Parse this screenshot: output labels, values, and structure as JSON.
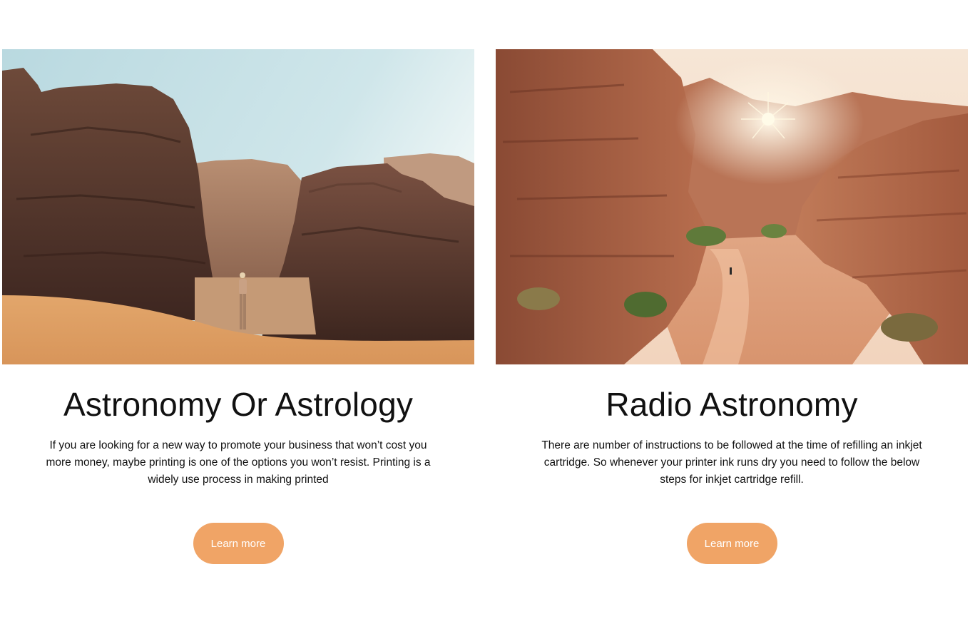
{
  "cards": [
    {
      "image_alt": "Person standing on a sand dune facing tall desert rock formations",
      "title": "Astronomy Or Astrology",
      "text": "If you are looking for a new way to promote your business that won’t cost you more money, maybe printing is one of the options you won’t resist. Printing is a widely use process in making printed",
      "button_label": "Learn more"
    },
    {
      "image_alt": "Aerial view of a red sandstone canyon with a sandy path and the sun flaring over the cliffs",
      "title": "Radio Astronomy",
      "text": "There are number of instructions to be followed at the time of refilling an inkjet cartridge. So whenever your printer ink runs dry you need to follow the below steps for inkjet cartridge refill.",
      "button_label": "Learn more"
    }
  ],
  "colors": {
    "button_bg": "#f0a466",
    "button_text": "#ffffff",
    "text": "#111111",
    "background": "#ffffff"
  }
}
